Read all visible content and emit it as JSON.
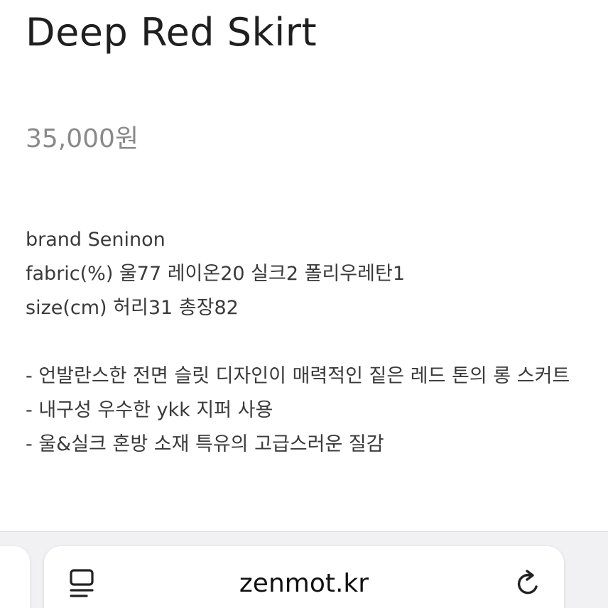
{
  "product": {
    "title": "Deep Red Skirt",
    "price": "35,000원"
  },
  "description": {
    "brand": "brand Seninon",
    "fabric": "fabric(%) 울77 레이온20 실크2 폴리우레탄1",
    "size": "size(cm) 허리31 총장82",
    "points": [
      "- 언발란스한 전면 슬릿 디자인이 매력적인 짙은 레드 톤의 롱 스커트",
      "- 내구성 우수한 ykk 지퍼 사용",
      "- 울&실크 혼방 소재 특유의 고급스러운 질감"
    ]
  },
  "browser": {
    "url": "zenmot.kr",
    "icons": {
      "reader": "reader-mode-icon",
      "reload": "reload-icon"
    }
  },
  "colors": {
    "title": "#1f1f1f",
    "price": "#8a8a8a",
    "body_text": "#3a3a3a",
    "toolbar_bg": "#f1f1f3"
  }
}
